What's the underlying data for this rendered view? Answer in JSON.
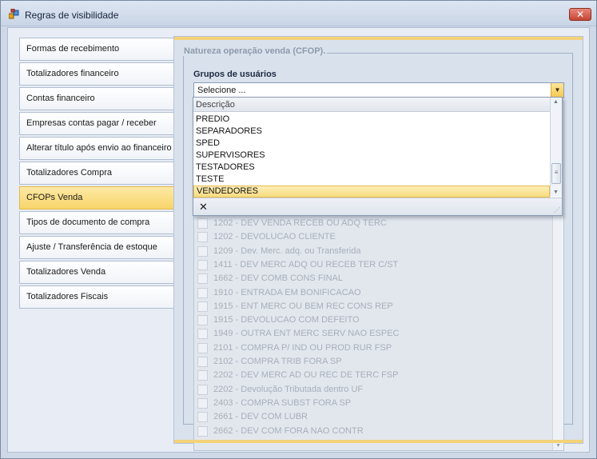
{
  "window": {
    "title": "Regras de visibilidade",
    "close_label": "✕"
  },
  "tabs": [
    {
      "label": "Formas de recebimento",
      "active": false
    },
    {
      "label": "Totalizadores financeiro",
      "active": false
    },
    {
      "label": "Contas financeiro",
      "active": false
    },
    {
      "label": "Empresas contas pagar / receber",
      "active": false
    },
    {
      "label": "Alterar título após envio ao financeiro",
      "active": false
    },
    {
      "label": "Totalizadores Compra",
      "active": false
    },
    {
      "label": "CFOPs Venda",
      "active": true
    },
    {
      "label": "Tipos de documento de compra",
      "active": false
    },
    {
      "label": "Ajuste / Transferência de estoque",
      "active": false
    },
    {
      "label": "Totalizadores Venda",
      "active": false
    },
    {
      "label": "Totalizadores Fiscais",
      "active": false
    }
  ],
  "panel": {
    "group_title": "Natureza operação venda (CFOP).",
    "user_groups_label": "Grupos de usuários",
    "combo": {
      "value": "Selecione ..."
    },
    "cfop_list": [
      "1202 - DEV VENDA RECEB OU ADQ TERC",
      "1202 - DEVOLUCAO CLIENTE",
      "1209 - Dev. Merc. adq. ou Transferida",
      "1411 - DEV MERC ADQ OU RECEB TER C/ST",
      "1662 - DEV COMB CONS FINAL",
      "1910 - ENTRADA EM BONIFICACAO",
      "1915 - ENT MERC OU BEM REC CONS REP",
      "1915 - DEVOLUCAO COM DEFEITO",
      "1949 - OUTRA ENT MERC SERV NAO ESPEC",
      "2101 - COMPRA P/ IND OU PROD RUR FSP",
      "2102 - COMPRA TRIB FORA SP",
      "2202 - DEV MERC AD OU REC DE TERC FSP",
      "2202 - Devolução Tributada dentro UF",
      "2403 - COMPRA SUBST FORA SP",
      "2661 - DEV COM LUBR",
      "2662 - DEV COM FORA NAO CONTR"
    ]
  },
  "dropdown": {
    "header": "Descrição",
    "items": [
      {
        "label": "PREDIO",
        "selected": false
      },
      {
        "label": "SEPARADORES",
        "selected": false
      },
      {
        "label": "SPED",
        "selected": false
      },
      {
        "label": "SUPERVISORES",
        "selected": false
      },
      {
        "label": "TESTADORES",
        "selected": false
      },
      {
        "label": "TESTE",
        "selected": false
      },
      {
        "label": "VENDEDORES",
        "selected": true
      }
    ],
    "clear_label": "✕"
  },
  "colors": {
    "active_tab": "#f8d56a",
    "selected_item": "#f8dc80",
    "accent_band": "#f4d27a"
  }
}
